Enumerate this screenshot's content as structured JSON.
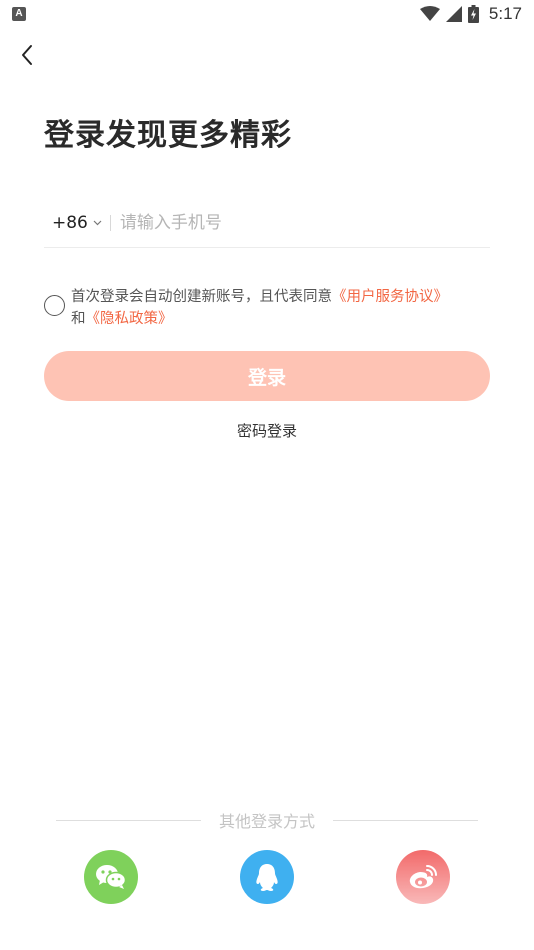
{
  "status_bar": {
    "badge": "A",
    "time": "5:17"
  },
  "title": "登录发现更多精彩",
  "phone": {
    "country_code": "+86",
    "placeholder": "请输入手机号",
    "value": ""
  },
  "agreement": {
    "text_before": "首次登录会自动创建新账号，且代表同意",
    "link_service": "《用户服务协议》",
    "text_and": "和",
    "link_privacy": "《隐私政策》"
  },
  "login_button": "登录",
  "password_login": "密码登录",
  "other_login": {
    "label": "其他登录方式",
    "methods": [
      "wechat",
      "qq",
      "weibo"
    ]
  },
  "colors": {
    "accent": "#f26744",
    "button_disabled": "#fec3b4",
    "wechat": "#7fd15b",
    "qq": "#3fb0f0",
    "weibo": "#f26a6a"
  }
}
